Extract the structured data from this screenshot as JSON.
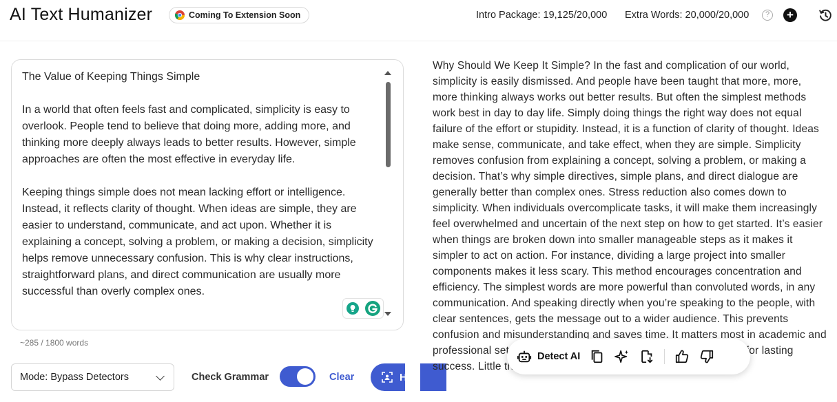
{
  "header": {
    "app_title": "AI Text Humanizer",
    "extension_badge": "Coming To Extension Soon",
    "intro_package": "Intro Package: 19,125/20,000",
    "extra_words": "Extra Words: 20,000/20,000",
    "help_symbol": "?",
    "add_symbol": "+"
  },
  "input": {
    "paragraphs": [
      "The Value of Keeping Things Simple",
      "In a world that often feels fast and complicated, simplicity is easy to overlook. People tend to believe that doing more, adding more, and thinking more deeply always leads to better results. However, simple approaches are often the most effective in everyday life.",
      "Keeping things simple does not mean lacking effort or intelligence. Instead, it reflects clarity of thought. When ideas are simple, they are easier to understand, communicate, and act upon. Whether it is explaining a concept, solving a problem, or making a decision, simplicity helps remove unnecessary confusion. This is why clear instructions, straightforward plans, and direct communication are usually more successful than overly complex ones."
    ],
    "word_count": "~285 / 1800 words"
  },
  "controls": {
    "mode_label": "Mode: Bypass Detectors",
    "check_grammar_label": "Check Grammar",
    "check_grammar_on": true,
    "clear_label": "Clear",
    "humanize_label": "H"
  },
  "output": {
    "text": "Why Should We Keep It Simple? In the fast and complication of our world, simplicity is easily dismissed. And people have been taught that more, more, more thinking always works out better results. But often the simplest methods work best in day to day life. Simply doing things the right way does not equal failure of the effort or stupidity. Instead, it is a function of clarity of thought. Ideas make sense, communicate, and take effect, when they are simple. Simplicity removes confusion from explaining a concept, solving a problem, or making a decision. That’s why simple directives, simple plans, and direct dialogue are generally better than complex ones. Stress reduction also comes down to simplicity. When individuals overcomplicate tasks, it will make them increasingly feel overwhelmed and uncertain of the next step on how to get started. It’s easier when things are broken down into smaller manageable steps as it makes it simpler to act on action. For instance, dividing a large project into smaller components makes it less scary. This method encourages concentration and efficiency. The simplest words are more powerful than convoluted words, in any communication. And speaking directly when you’re speaking to the people, with clear sentences, gets the message out to a wider audience. This prevents confusion and misunderstanding and saves time. It matters most in academic and professional settings. What’s more, basic habits can do wonders for lasting success. Little things, things that",
    "toolbar": {
      "detect_ai_label": "Detect AI"
    }
  },
  "colors": {
    "accent": "#3f5bd0",
    "grammarly_green": "#15a37f"
  },
  "icons": [
    "chrome-icon",
    "help-icon",
    "add-icon",
    "history-icon",
    "bulb-icon",
    "grammarly-icon",
    "chevron-down-icon",
    "scan-icon",
    "robot-icon",
    "copy-icon",
    "sparkle-icon",
    "download-icon",
    "thumbs-up-icon",
    "thumbs-down-icon"
  ]
}
